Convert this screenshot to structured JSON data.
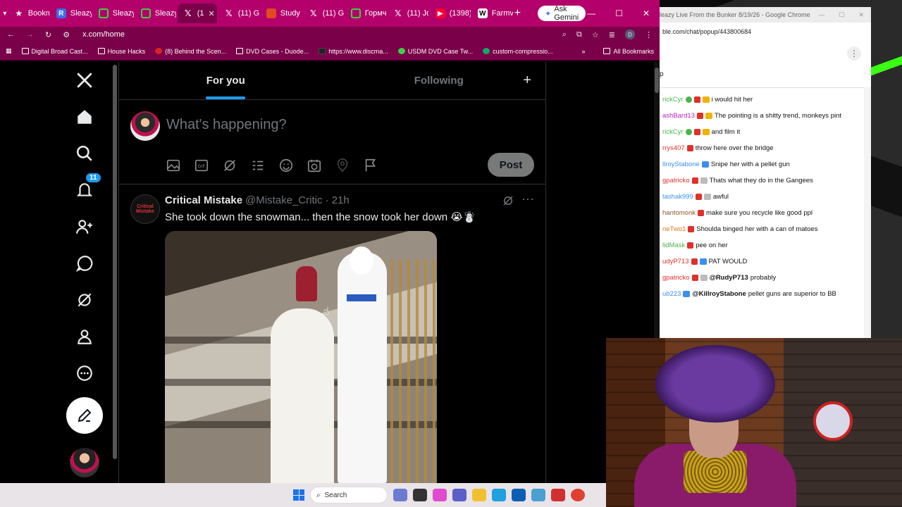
{
  "browser": {
    "tabs": [
      {
        "icon": "bookmark-star-icon",
        "label": "Bookm"
      },
      {
        "icon": "r-app-icon",
        "label": "Sleazy"
      },
      {
        "icon": "green-app-icon",
        "label": "Sleazy"
      },
      {
        "icon": "green-app-icon",
        "label": "Sleazy"
      },
      {
        "icon": "x-logo-icon",
        "label": "(1",
        "active": true
      },
      {
        "icon": "x-logo-icon",
        "label": "(11) G"
      },
      {
        "icon": "study-app-icon",
        "label": "Study"
      },
      {
        "icon": "x-logo-icon",
        "label": "(11) G"
      },
      {
        "icon": "green-app-icon",
        "label": "Гормч"
      },
      {
        "icon": "x-logo-icon",
        "label": "(11) Jo"
      },
      {
        "icon": "youtube-icon",
        "label": "(1398)"
      },
      {
        "icon": "w-app-icon",
        "label": "Farmv"
      }
    ],
    "ask_gemini": "Ask Gemini",
    "url": "x.com/home",
    "profile_letter": "D",
    "bookmarks": [
      {
        "label": "Digital Broad Cast...",
        "icon": "folder"
      },
      {
        "label": "House Hacks",
        "icon": "folder"
      },
      {
        "label": "(8) Behind the Scen...",
        "icon": "red"
      },
      {
        "label": "DVD Cases - Duode...",
        "icon": "folder"
      },
      {
        "label": "https://www.discma...",
        "icon": "dark"
      },
      {
        "label": "USDM DVD Case Tw...",
        "icon": "grn"
      },
      {
        "label": "custom-compressio...",
        "icon": "globe"
      }
    ],
    "all_bookmarks": "All Bookmarks"
  },
  "nav": {
    "notification_count": "11"
  },
  "feed": {
    "tab_for_you": "For you",
    "tab_following": "Following",
    "composer_placeholder": "What's happening?",
    "post_label": "Post"
  },
  "tweet": {
    "avatar_text": "Critical Mistake",
    "name": "Critical Mistake",
    "handle": "@Mistake_Critic",
    "time": "· 21h",
    "text": "She took down the snowman... then the snow took her down 😭☃️"
  },
  "chat_window": {
    "title": "leazy Live From the Bunker 8/19/26 - Google Chrome",
    "url": "ble.com/chat/popup/443800684",
    "header_letter": "p",
    "messages": [
      {
        "user": "rickCyr",
        "color": "#47b548",
        "badges": [
          "grn",
          "red",
          "ylw"
        ],
        "text": "i would hit her"
      },
      {
        "user": "ashBard13",
        "color": "#c020c0",
        "badges": [
          "red",
          "ylw"
        ],
        "text": "The pointing is a shitty trend, monkeys pint"
      },
      {
        "user": "rickCyr",
        "color": "#47b548",
        "badges": [
          "grn",
          "red",
          "ylw"
        ],
        "text": "and film it"
      },
      {
        "user": "rrys407",
        "color": "#e0302a",
        "badges": [
          "red"
        ],
        "text": "throw here over the bridge"
      },
      {
        "user": "llroyStabone",
        "color": "#3b8ff0",
        "badges": [
          "blu"
        ],
        "text": "Snipe her with a pellet gun"
      },
      {
        "user": "gpatricko",
        "color": "#e0302a",
        "badges": [
          "red",
          "gry"
        ],
        "text": "Thats what they do in the Gangees"
      },
      {
        "user": "tashak999",
        "color": "#3b8ff0",
        "badges": [
          "red",
          "gry"
        ],
        "text": "awful"
      },
      {
        "user": "hantomonk",
        "color": "#8a5a2a",
        "badges": [
          "red"
        ],
        "text": "make sure you recycle like good ppl"
      },
      {
        "user": "neTwo1",
        "color": "#e07a1a",
        "badges": [
          "red"
        ],
        "text": "Shoulda binged her with a can of matoes"
      },
      {
        "user": "lidMask",
        "color": "#47b548",
        "badges": [
          "red"
        ],
        "text": "pee on her"
      },
      {
        "user": "udyP713",
        "color": "#e0302a",
        "badges": [
          "red",
          "blu"
        ],
        "text": "PAT WOULD"
      },
      {
        "user": "gpatricko",
        "color": "#e0302a",
        "badges": [
          "red",
          "gry"
        ],
        "mention": "@RudyP713",
        "text": "probably"
      },
      {
        "user": "ub223",
        "color": "#3b8ff0",
        "badges": [
          "blu"
        ],
        "mention": "@KillroyStabone",
        "text": "pellet guns are superior to BB"
      }
    ]
  },
  "taskbar": {
    "search_label": "Search"
  }
}
